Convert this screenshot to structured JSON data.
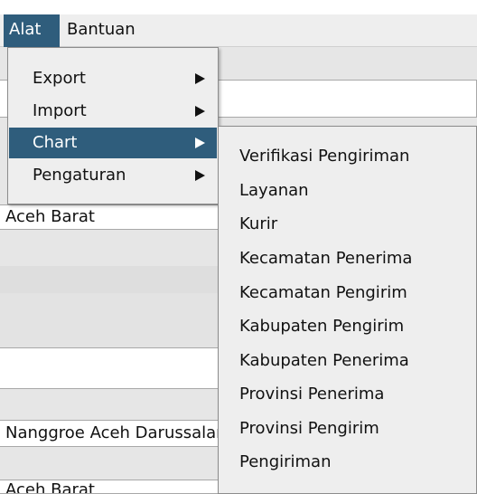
{
  "menubar": {
    "items": [
      {
        "label": "Alat",
        "active": true
      },
      {
        "label": "Bantuan",
        "active": false
      }
    ]
  },
  "alat_menu": {
    "items": [
      {
        "label": "Export",
        "has_submenu": true,
        "highlighted": false
      },
      {
        "label": "Import",
        "has_submenu": true,
        "highlighted": false
      },
      {
        "label": "Chart",
        "has_submenu": true,
        "highlighted": true
      },
      {
        "label": "Pengaturan",
        "has_submenu": true,
        "highlighted": false
      }
    ]
  },
  "chart_submenu": {
    "items": [
      {
        "label": "Verifikasi Pengiriman"
      },
      {
        "label": "Layanan"
      },
      {
        "label": "Kurir"
      },
      {
        "label": "Kecamatan Penerima"
      },
      {
        "label": "Kecamatan Pengirim"
      },
      {
        "label": "Kabupaten Pengirim"
      },
      {
        "label": "Kabupaten Penerima"
      },
      {
        "label": "Provinsi Penerima"
      },
      {
        "label": "Provinsi Pengirim"
      },
      {
        "label": "Pengiriman"
      }
    ]
  },
  "background_form": {
    "field_1_value": "Aceh Barat",
    "field_2_value": "Nanggroe Aceh Darussalam",
    "field_3_value": "Aceh Barat"
  },
  "colors": {
    "highlight": "#2f5d7c",
    "menu_bg": "#eeeeee"
  }
}
